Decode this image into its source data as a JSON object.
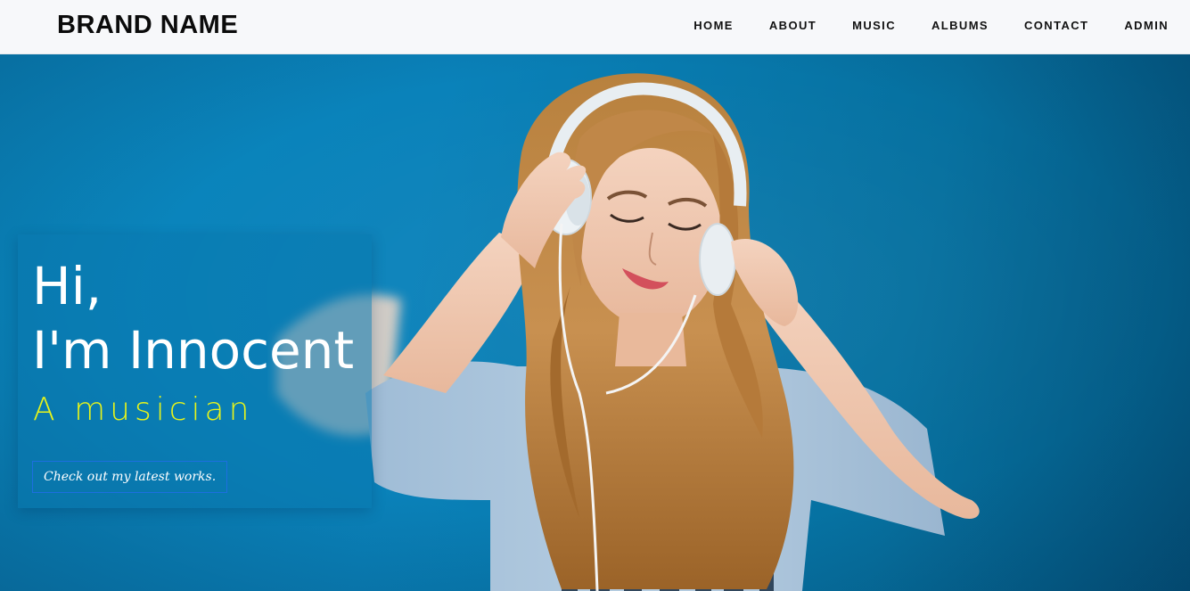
{
  "navbar": {
    "brand": "BRAND NAME",
    "links": [
      {
        "label": "HOME"
      },
      {
        "label": "ABOUT"
      },
      {
        "label": "MUSIC"
      },
      {
        "label": "ALBUMS"
      },
      {
        "label": "CONTACT"
      },
      {
        "label": "ADMIN"
      }
    ]
  },
  "hero": {
    "greeting_line1": "Hi,",
    "greeting_line2": "I'm Innocent",
    "subtitle": "A musician",
    "cta_label": "Check out my latest works."
  },
  "colors": {
    "hero_background": "#0a82ba",
    "subtitle": "#e8f51a",
    "cta_border": "#1d6fe0",
    "navbar_background": "#f7f8fa"
  }
}
